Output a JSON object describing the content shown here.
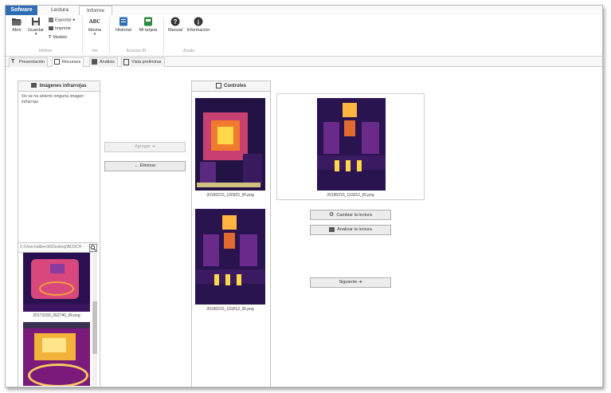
{
  "app": {
    "logo": "Sofware",
    "ribbon_tabs": [
      {
        "label": "Lectura"
      },
      {
        "label": "Informe"
      }
    ]
  },
  "ribbon": {
    "open": "Abrir",
    "save": "Guardar",
    "export": "Exportar",
    "print": "Imprimir",
    "model": "Modelo",
    "language_icon_text": "ABC",
    "language": "Idioma",
    "history": "Historial",
    "my_card": "Mi tarjeta",
    "manual": "Manual",
    "info": "Información",
    "groups": {
      "report": "Informe",
      "view": "Ver",
      "account": "Accesso IR",
      "help": "Ayuda"
    }
  },
  "page_tabs": [
    {
      "label": "Presentación",
      "icon": "text-t-icon"
    },
    {
      "label": "Recursos",
      "icon": "grid-icon"
    },
    {
      "label": "Análisis",
      "icon": "chart-icon"
    },
    {
      "label": "Vista preliminar",
      "icon": "document-icon"
    }
  ],
  "left_panel": {
    "title": "Imágenes infrarrojas",
    "empty_text_line1": "No se ha abierto ninguna imagen",
    "empty_text_line2": "infrarroja",
    "path": "C:\\Users\\albrecht\\Desktop\\BOSCH",
    "thumbnails": [
      {
        "caption": "20171030_062740_IR.png"
      }
    ]
  },
  "middle": {
    "add_button": "Agregar ➜",
    "remove_button": "← Eliminar"
  },
  "controls_panel": {
    "title": "Controles",
    "images": [
      {
        "caption": "20180215_100922_IR.png"
      },
      {
        "caption": "20180215_103012_IR.png"
      }
    ]
  },
  "preview": {
    "caption": "20180215_103012_IR.png",
    "change_button": "Cambiar la lectura",
    "analyze_button": "Analizar la lectura",
    "next_button": "Siguiente ➜"
  },
  "colors": {
    "accent": "#2f6db5",
    "thermal_dark": "#1c0f3a",
    "thermal_hot": "#ffd84a"
  }
}
